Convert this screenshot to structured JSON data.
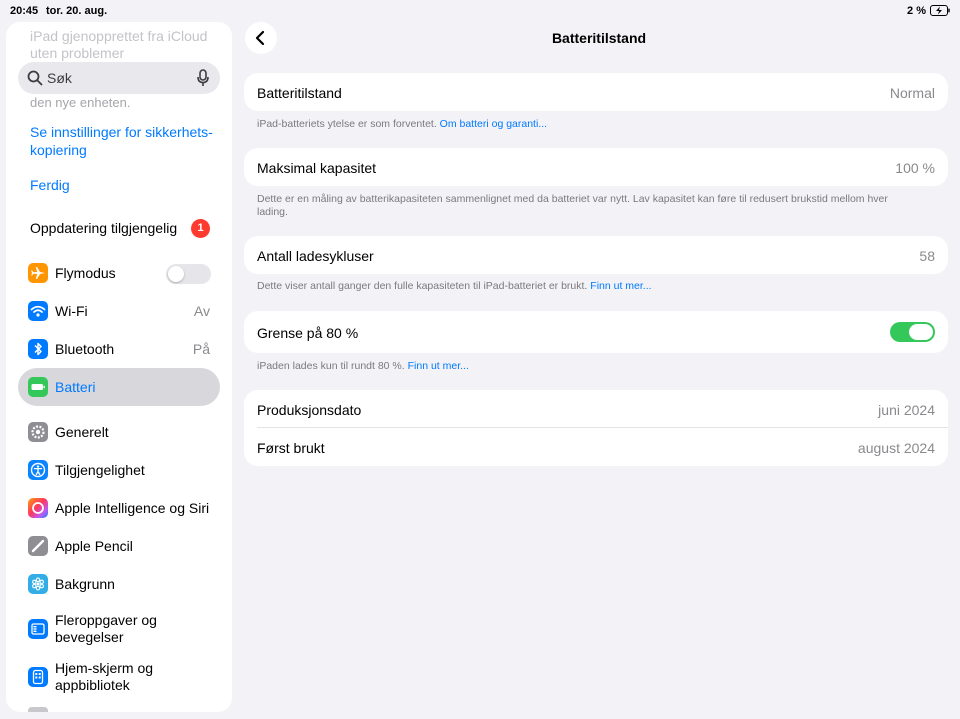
{
  "status_bar": {
    "time": "20:45",
    "date": "tor. 20. aug.",
    "battery_percent": "2 %"
  },
  "sidebar": {
    "faded_top": "iPad gjenopprettet fra iCloud uten problemer",
    "faded_mid": "den nye enheten.",
    "search": {
      "placeholder": "Søk"
    },
    "backup_settings_link": "Se innstillinger for sikkerhets-kopiering",
    "done_link": "Ferdig",
    "update": {
      "label": "Oppdatering tilgjengelig",
      "badge": "1"
    },
    "items": [
      {
        "label": "Flymodus",
        "icon": "airplane-icon",
        "color": "#ff9500",
        "toggle": false
      },
      {
        "label": "Wi-Fi",
        "value": "Av",
        "icon": "wifi-icon",
        "color": "#007aff"
      },
      {
        "label": "Bluetooth",
        "value": "På",
        "icon": "bluetooth-icon",
        "color": "#007aff"
      },
      {
        "label": "Batteri",
        "icon": "battery-icon",
        "color": "#34c759",
        "selected": true
      },
      {
        "label": "Generelt",
        "icon": "gear-icon",
        "color": "#8e8e93"
      },
      {
        "label": "Tilgjengelighet",
        "icon": "accessibility-icon",
        "color": "#0a84ff"
      },
      {
        "label": "Apple Intelligence og Siri",
        "icon": "siri-icon",
        "color": "#ff6482"
      },
      {
        "label": "Apple Pencil",
        "icon": "pencil-icon",
        "color": "#8e8e93"
      },
      {
        "label": "Bakgrunn",
        "icon": "wallpaper-icon",
        "color": "#32ade6"
      },
      {
        "label": "Fleroppgaver og bevegelser",
        "icon": "multitasking-icon",
        "color": "#007aff"
      },
      {
        "label": "Hjem-skjerm og appbibliotek",
        "icon": "homescreen-icon",
        "color": "#007aff"
      }
    ]
  },
  "main": {
    "title": "Batteritilstand",
    "health": {
      "label": "Batteritilstand",
      "value": "Normal"
    },
    "health_footer": {
      "text": "iPad-batteriets ytelse er som forventet.",
      "link": "Om batteri og garanti..."
    },
    "capacity": {
      "label": "Maksimal kapasitet",
      "value": "100 %"
    },
    "capacity_footer": "Dette er en måling av batterikapasiteten sammenlignet med da batteriet var nytt. Lav kapasitet kan føre til redusert brukstid mellom hver lading.",
    "cycles": {
      "label": "Antall ladesykluser",
      "value": "58"
    },
    "cycles_footer": {
      "text": "Dette viser antall ganger den fulle kapasiteten til iPad-batteriet er brukt.",
      "link": "Finn ut mer..."
    },
    "limit": {
      "label": "Grense på 80 %",
      "enabled": true
    },
    "limit_footer": {
      "text": "iPaden lades kun til rundt 80 %.",
      "link": "Finn ut mer..."
    },
    "manufacture": {
      "label": "Produksjonsdato",
      "value": "juni 2024"
    },
    "first_use": {
      "label": "Først brukt",
      "value": "august 2024"
    }
  }
}
